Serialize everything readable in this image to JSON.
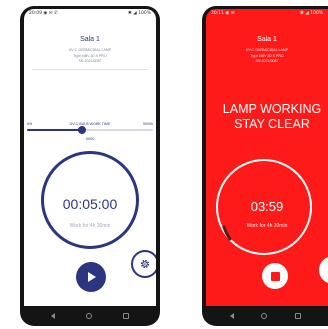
{
  "left_screen": {
    "status_left": "20:09 ◉ ✉ ✆",
    "status_right": "✱ ◢ 100%",
    "room_title": "Sala 1",
    "device_lines": [
      "UV-C GERMICIDAL LAMP",
      "Type NBV 30 S PRO",
      "SN 2021/0087"
    ],
    "slider": {
      "min_label": "5%",
      "title": "UV-C BULB WORK TIME",
      "max_label": "9000h",
      "value_label": "4000",
      "fraction": 0.44
    },
    "timer": "00:05:00",
    "work_text": "Work for 4h 30min",
    "play_icon": "play-icon",
    "settings_icon": "gear-icon",
    "accent_color": "#2b3580"
  },
  "right_screen": {
    "status_left": "20:11 ◉ ✉",
    "status_right": "✱ ◢ 100%",
    "room_title": "Sala 1",
    "device_lines": [
      "UV-C GERMICIDAL LAMP",
      "Type NBV 30 S PRO",
      "SN 2021/0087"
    ],
    "warning_line1": "LAMP WORKING",
    "warning_line2": "STAY CLEAR",
    "timer": "03:59",
    "work_text": "Work for 4h 30min",
    "stop_icon": "stop-icon",
    "background_color": "#ff1a1a"
  },
  "navbar": {
    "back_icon": "back-icon",
    "home_icon": "home-icon",
    "recent_icon": "recent-apps-icon"
  }
}
